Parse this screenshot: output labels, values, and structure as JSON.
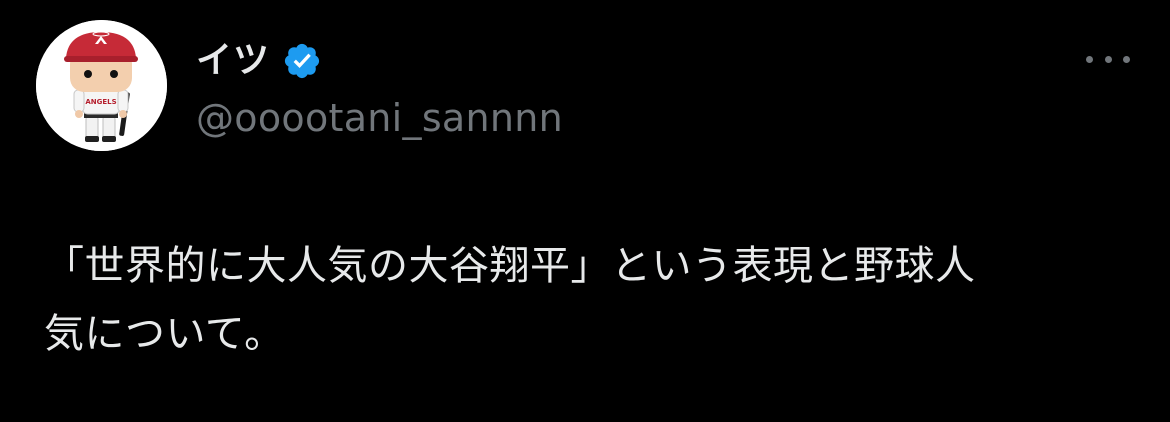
{
  "author": {
    "display_name": "イツ",
    "handle": "@ooootani_sannnn",
    "verified": true,
    "avatar_icon": "baseball-player-figure-avatar"
  },
  "icons": {
    "verified": "verified-badge-icon",
    "more": "more-options-icon"
  },
  "colors": {
    "background": "#000000",
    "text": "#e7e9ea",
    "secondary": "#71767b",
    "verified": "#1d9bf0"
  },
  "tweet": {
    "text_line_1": "「世界的に大人気の大谷翔平」という表現と野球人",
    "text_line_2": "気について。"
  }
}
